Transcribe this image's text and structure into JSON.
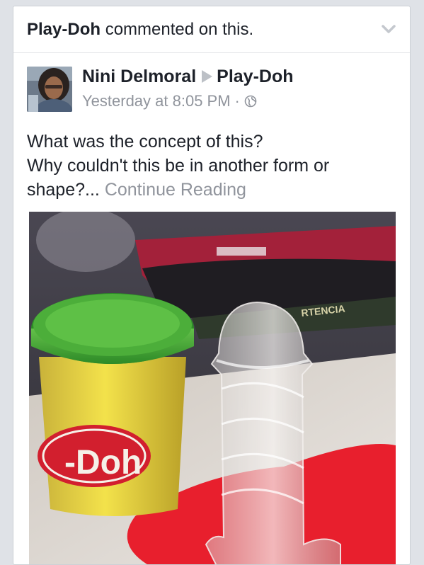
{
  "story": {
    "actor": "Play-Doh",
    "action": "commented on this."
  },
  "post": {
    "author": "Nini Delmoral",
    "target": "Play-Doh",
    "timestamp": "Yesterday at 8:05 PM",
    "separator": "·",
    "privacy_icon": "globe-icon",
    "text_line1": "What was the concept of this?",
    "text_line2": "Why couldn't this be in another form or",
    "text_line3": "shape?...",
    "continue_label": "Continue Reading"
  },
  "photo": {
    "logo_text": "-Doh",
    "box_text": "RTENCIA"
  },
  "colors": {
    "background": "#dfe2e7",
    "text": "#1d2129",
    "muted": "#90949c"
  }
}
